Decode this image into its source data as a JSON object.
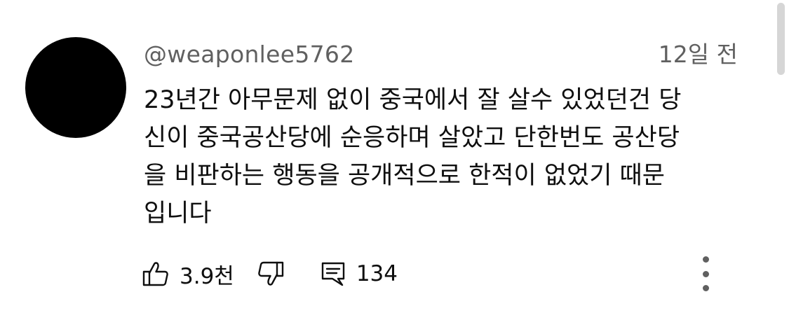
{
  "comment": {
    "author": "@weaponlee5762",
    "timestamp": "12일 전",
    "text_lines": [
      "23년간 아무문제 없이 중국에서 잘 살수 있었던건 당",
      "신이 중국공산당에 순응하며 살았고 단한번도 공산당",
      "을 비판하는 행동을 공개적으로 한적이 없었기 때문",
      "입니다"
    ],
    "like_count": "3.9천",
    "reply_count": "134"
  },
  "icons": {
    "like": "thumbs-up-icon",
    "dislike": "thumbs-down-icon",
    "reply": "reply-comment-icon",
    "more": "more-vertical-icon"
  },
  "colors": {
    "text": "#0f0f0f",
    "secondary_text": "#606060",
    "avatar": "#000000",
    "scrollbar": "#d6d6d6"
  }
}
